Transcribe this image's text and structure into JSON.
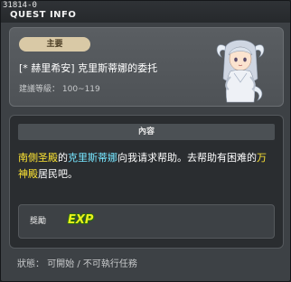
{
  "window": {
    "quest_id": "31814-0",
    "title": "QUEST INFO"
  },
  "quest": {
    "category": "主要",
    "name": "[* 赫里希安] 克里斯蒂娜的委托",
    "level_requirement": "建議等級： 100~119",
    "npc_portrait": "npc-portrait-icon"
  },
  "content": {
    "header": "內容",
    "description": {
      "part1": "南側圣殿",
      "part2": "的",
      "part3": "克里斯蒂娜",
      "part4": "向我请求帮助。去帮助有困难的",
      "part5": "万神殿",
      "part6": "居民吧。"
    }
  },
  "reward": {
    "label": "獎勵",
    "exp_label": "EXP"
  },
  "status": {
    "text": "狀態： 可開始 / 不可執行任務"
  },
  "colors": {
    "highlight_place": "#ffe633",
    "highlight_npc": "#76e6ff",
    "badge_bg": "#d9c9a6"
  }
}
